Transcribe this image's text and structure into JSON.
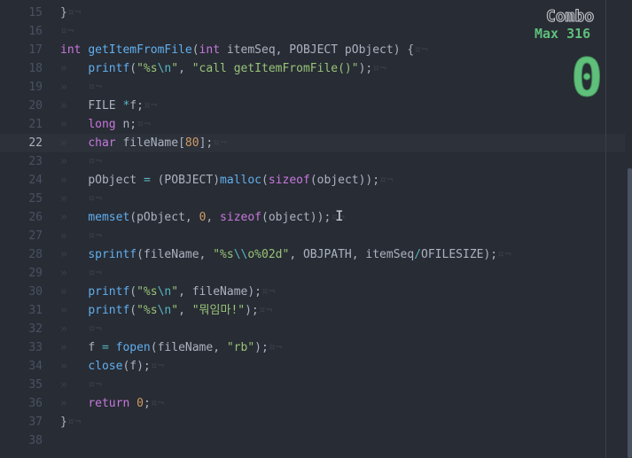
{
  "editor": {
    "lines": [
      {
        "num": "15",
        "tokens": [
          {
            "t": "pl",
            "v": "}"
          },
          {
            "t": "inv",
            "v": "¤¬"
          }
        ]
      },
      {
        "num": "16",
        "tokens": [
          {
            "t": "inv",
            "v": "¤¬"
          }
        ]
      },
      {
        "num": "17",
        "tokens": [
          {
            "t": "kw",
            "v": "int "
          },
          {
            "t": "fn",
            "v": "getItemFromFile"
          },
          {
            "t": "pl",
            "v": "("
          },
          {
            "t": "kw",
            "v": "int"
          },
          {
            "t": "pl",
            "v": " itemSeq, POBJECT pObject) {"
          },
          {
            "t": "inv",
            "v": "¤¬"
          }
        ]
      },
      {
        "num": "18",
        "tokens": [
          {
            "t": "inv",
            "v": "»   "
          },
          {
            "t": "fn",
            "v": "printf"
          },
          {
            "t": "pl",
            "v": "("
          },
          {
            "t": "str",
            "v": "\"%s"
          },
          {
            "t": "esc",
            "v": "\\n"
          },
          {
            "t": "str",
            "v": "\""
          },
          {
            "t": "pl",
            "v": ", "
          },
          {
            "t": "str",
            "v": "\"call getItemFromFile()\""
          },
          {
            "t": "pl",
            "v": ");"
          },
          {
            "t": "inv",
            "v": "¤¬"
          }
        ]
      },
      {
        "num": "19",
        "tokens": [
          {
            "t": "inv",
            "v": "»   ¤¬"
          }
        ]
      },
      {
        "num": "20",
        "tokens": [
          {
            "t": "inv",
            "v": "»   "
          },
          {
            "t": "pl",
            "v": "FILE "
          },
          {
            "t": "op",
            "v": "*"
          },
          {
            "t": "pl",
            "v": "f;"
          },
          {
            "t": "inv",
            "v": "¤¬"
          }
        ]
      },
      {
        "num": "21",
        "tokens": [
          {
            "t": "inv",
            "v": "»   "
          },
          {
            "t": "kw",
            "v": "long"
          },
          {
            "t": "pl",
            "v": " n;"
          },
          {
            "t": "inv",
            "v": "¤¬"
          }
        ]
      },
      {
        "num": "22",
        "tokens": [
          {
            "t": "inv",
            "v": "»   "
          },
          {
            "t": "kw",
            "v": "char"
          },
          {
            "t": "pl",
            "v": " fileName["
          },
          {
            "t": "num",
            "v": "80"
          },
          {
            "t": "pl",
            "v": "];"
          },
          {
            "t": "inv",
            "v": "¤¬"
          }
        ]
      },
      {
        "num": "23",
        "tokens": [
          {
            "t": "inv",
            "v": "»   ¤¬"
          }
        ]
      },
      {
        "num": "24",
        "tokens": [
          {
            "t": "inv",
            "v": "»   "
          },
          {
            "t": "pl",
            "v": "pObject "
          },
          {
            "t": "op",
            "v": "="
          },
          {
            "t": "pl",
            "v": " (POBJECT)"
          },
          {
            "t": "fn",
            "v": "malloc"
          },
          {
            "t": "pl",
            "v": "("
          },
          {
            "t": "kw",
            "v": "sizeof"
          },
          {
            "t": "pl",
            "v": "(object));"
          },
          {
            "t": "inv",
            "v": "¤¬"
          }
        ]
      },
      {
        "num": "25",
        "tokens": [
          {
            "t": "inv",
            "v": "»   ¤¬"
          }
        ]
      },
      {
        "num": "26",
        "tokens": [
          {
            "t": "inv",
            "v": "»   "
          },
          {
            "t": "fn",
            "v": "memset"
          },
          {
            "t": "pl",
            "v": "(pObject, "
          },
          {
            "t": "num",
            "v": "0"
          },
          {
            "t": "pl",
            "v": ", "
          },
          {
            "t": "kw",
            "v": "sizeof"
          },
          {
            "t": "pl",
            "v": "(object));"
          },
          {
            "t": "inv",
            "v": "¤¬"
          }
        ]
      },
      {
        "num": "27",
        "tokens": [
          {
            "t": "inv",
            "v": "»   ¤¬"
          }
        ]
      },
      {
        "num": "28",
        "tokens": [
          {
            "t": "inv",
            "v": "»   "
          },
          {
            "t": "fn",
            "v": "sprintf"
          },
          {
            "t": "pl",
            "v": "(fileName, "
          },
          {
            "t": "str",
            "v": "\"%s"
          },
          {
            "t": "esc",
            "v": "\\\\"
          },
          {
            "t": "str",
            "v": "o%02d\""
          },
          {
            "t": "pl",
            "v": ", OBJPATH, itemSeq"
          },
          {
            "t": "op",
            "v": "/"
          },
          {
            "t": "pl",
            "v": "OFILESIZE);"
          },
          {
            "t": "inv",
            "v": "¤¬"
          }
        ]
      },
      {
        "num": "29",
        "tokens": [
          {
            "t": "inv",
            "v": "»   ¤¬"
          }
        ]
      },
      {
        "num": "30",
        "tokens": [
          {
            "t": "inv",
            "v": "»   "
          },
          {
            "t": "fn",
            "v": "printf"
          },
          {
            "t": "pl",
            "v": "("
          },
          {
            "t": "str",
            "v": "\"%s"
          },
          {
            "t": "esc",
            "v": "\\n"
          },
          {
            "t": "str",
            "v": "\""
          },
          {
            "t": "pl",
            "v": ", fileName);"
          },
          {
            "t": "inv",
            "v": "¤¬"
          }
        ]
      },
      {
        "num": "31",
        "tokens": [
          {
            "t": "inv",
            "v": "»   "
          },
          {
            "t": "fn",
            "v": "printf"
          },
          {
            "t": "pl",
            "v": "("
          },
          {
            "t": "str",
            "v": "\"%s"
          },
          {
            "t": "esc",
            "v": "\\n"
          },
          {
            "t": "str",
            "v": "\""
          },
          {
            "t": "pl",
            "v": ", "
          },
          {
            "t": "str",
            "v": "\"뭐임마!\""
          },
          {
            "t": "pl",
            "v": ");"
          },
          {
            "t": "inv",
            "v": "¤¬"
          }
        ]
      },
      {
        "num": "32",
        "tokens": [
          {
            "t": "inv",
            "v": "»   ¤¬"
          }
        ]
      },
      {
        "num": "33",
        "tokens": [
          {
            "t": "inv",
            "v": "»   "
          },
          {
            "t": "pl",
            "v": "f "
          },
          {
            "t": "op",
            "v": "="
          },
          {
            "t": "pl",
            "v": " "
          },
          {
            "t": "fn",
            "v": "fopen"
          },
          {
            "t": "pl",
            "v": "(fileName, "
          },
          {
            "t": "str",
            "v": "\"rb\""
          },
          {
            "t": "pl",
            "v": ");"
          },
          {
            "t": "inv",
            "v": "¤¬"
          }
        ]
      },
      {
        "num": "34",
        "tokens": [
          {
            "t": "inv",
            "v": "»   "
          },
          {
            "t": "fn",
            "v": "close"
          },
          {
            "t": "pl",
            "v": "(f);"
          },
          {
            "t": "inv",
            "v": "¤¬"
          }
        ]
      },
      {
        "num": "35",
        "tokens": [
          {
            "t": "inv",
            "v": "»   ¤¬"
          }
        ]
      },
      {
        "num": "36",
        "tokens": [
          {
            "t": "inv",
            "v": "»   "
          },
          {
            "t": "kw",
            "v": "return"
          },
          {
            "t": "pl",
            "v": " "
          },
          {
            "t": "num",
            "v": "0"
          },
          {
            "t": "pl",
            "v": ";"
          },
          {
            "t": "inv",
            "v": "¤¬"
          }
        ]
      },
      {
        "num": "37",
        "tokens": [
          {
            "t": "pl",
            "v": "}"
          },
          {
            "t": "inv",
            "v": "¤¬"
          }
        ]
      },
      {
        "num": "38",
        "tokens": []
      }
    ],
    "current_line": "22"
  },
  "combo": {
    "title": "Combo",
    "max_label": "Max 316",
    "count": "0",
    "color": "#5fbf7b"
  },
  "cursor_icon": "text-cursor-icon"
}
